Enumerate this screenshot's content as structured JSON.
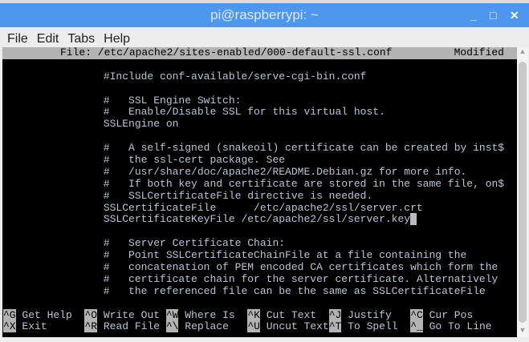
{
  "window": {
    "title": "pi@raspberrypi: ~"
  },
  "menu": [
    "File",
    "Edit",
    "Tabs",
    "Help"
  ],
  "nano": {
    "file_label": "File: /etc/apache2/sites-enabled/000-default-ssl.conf",
    "status": "Modified",
    "lines": [
      "",
      "                #Include conf-available/serve-cgi-bin.conf",
      "",
      "                #   SSL Engine Switch:",
      "                #   Enable/Disable SSL for this virtual host.",
      "                SSLEngine on",
      "",
      "                #   A self-signed (snakeoil) certificate can be created by inst$",
      "                #   the ssl-cert package. See",
      "                #   /usr/share/doc/apache2/README.Debian.gz for more info.",
      "                #   If both key and certificate are stored in the same file, on$",
      "                #   SSLCertificateFile directive is needed.",
      "                SSLCertificateFile      /etc/apache2/ssl/server.crt",
      "                SSLCertificateKeyFile /etc/apache2/ssl/server.key",
      "",
      "                #   Server Certificate Chain:",
      "                #   Point SSLCertificateChainFile at a file containing the",
      "                #   concatenation of PEM encoded CA certificates which form the",
      "                #   certificate chain for the server certificate. Alternatively",
      "                #   the referenced file can be the same as SSLCertificateFile",
      ""
    ],
    "shortcuts_row1": [
      {
        "key": "^G",
        "label": " Get Help  "
      },
      {
        "key": "^O",
        "label": " Write Out "
      },
      {
        "key": "^W",
        "label": " Where Is  "
      },
      {
        "key": "^K",
        "label": " Cut Text  "
      },
      {
        "key": "^J",
        "label": " Justify   "
      },
      {
        "key": "^C",
        "label": " Cur Pos"
      }
    ],
    "shortcuts_row2": [
      {
        "key": "^X",
        "label": " Exit      "
      },
      {
        "key": "^R",
        "label": " Read File "
      },
      {
        "key": "^\\",
        "label": " Replace   "
      },
      {
        "key": "^U",
        "label": " Uncut Text"
      },
      {
        "key": "^T",
        "label": " To Spell  "
      },
      {
        "key": "^_",
        "label": " Go To Line"
      }
    ]
  }
}
